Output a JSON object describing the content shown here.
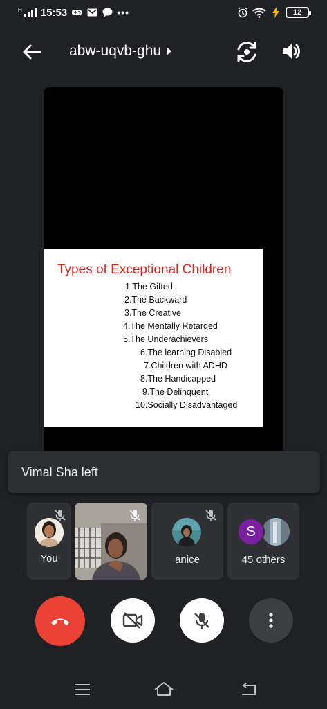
{
  "status_bar": {
    "time": "15:53",
    "network_label": "H",
    "battery": "12"
  },
  "header": {
    "meeting_code": "abw-uqvb-ghu"
  },
  "slide": {
    "title": "Types of Exceptional Children",
    "items": [
      "1.The Gifted",
      "2.The Backward",
      "3.The Creative",
      "4.The Mentally Retarded",
      "5.The Underachievers",
      "6.The learning Disabled",
      "7.Children with ADHD",
      "8.The Handicapped",
      "9.The Delinquent",
      "10.Socially Disadvantaged"
    ]
  },
  "toast": {
    "message": "Vimal Sha left"
  },
  "participants": [
    {
      "label": "You",
      "muted": true
    },
    {
      "label": "",
      "muted": true
    },
    {
      "label": "anice",
      "muted": true
    },
    {
      "label": "45 others",
      "avatar_letter": "S",
      "avatar_color": "#7b1fa2"
    }
  ],
  "colors": {
    "background": "#202124",
    "end_call": "#ea4335",
    "slide_title": "#d9261c"
  }
}
